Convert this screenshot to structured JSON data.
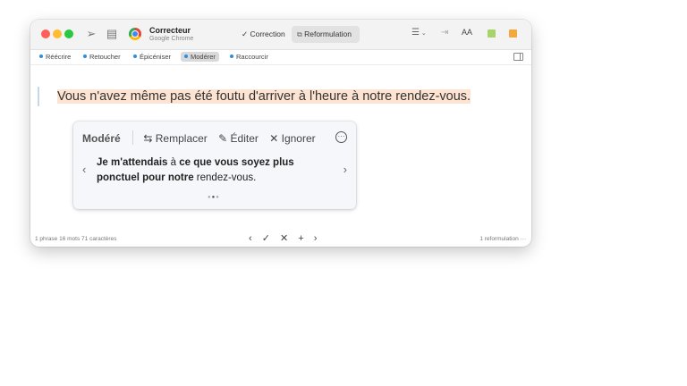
{
  "titlebar": {
    "app_title": "Correcteur",
    "app_subtitle": "Google Chrome",
    "segments": {
      "correction": "✓ Correction",
      "reformulation": "Reformulation"
    },
    "aa_label": "AA"
  },
  "modes": [
    "Réécrire",
    "Retoucher",
    "Épicéniser",
    "Modérer",
    "Raccourcir"
  ],
  "active_mode": "Modérer",
  "sentence": {
    "parts": [
      "Vous n'avez même pas été foutu d'arriver à l'heure à notre rendez-vous."
    ]
  },
  "suggestion": {
    "label": "Modéré",
    "actions": {
      "replace": "Remplacer",
      "edit": "Éditer",
      "ignore": "Ignorer"
    },
    "text_bold_1": "Je m'attendais",
    "text_plain_1": " à ",
    "text_bold_2": "ce que vous soyez plus ponctuel pour notre",
    "text_plain_2": " rendez-vous.",
    "page_current": 2,
    "page_total": 3
  },
  "status": {
    "left": "1 phrase  16 mots  71 caractères",
    "right": "1 reformulation  ···"
  },
  "colors": {
    "highlight": "#fde4d2",
    "mode_dot": "#2a8fe0"
  }
}
